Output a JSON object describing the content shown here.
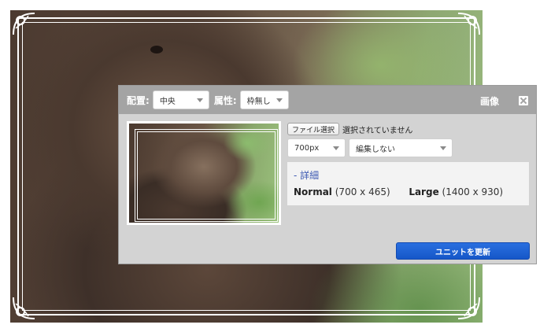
{
  "dialog": {
    "title": "画像",
    "close_icon": "close-icon",
    "header": {
      "align_label": "配置:",
      "align_value": "中央",
      "attribute_label": "属性:",
      "attribute_value": "枠無し"
    },
    "file": {
      "choose_label": "ファイル選択",
      "status": "選択されていません"
    },
    "size_select": "700px",
    "edit_select": "編集しない",
    "detail": {
      "toggle": "- 詳細",
      "normal_label": "Normal",
      "normal_size": "(700 x 465)",
      "large_label": "Large",
      "large_size": "(1400 x 930)"
    },
    "update_button": "ユニットを更新"
  },
  "colors": {
    "header_bg": "#a4a4a4",
    "dialog_bg": "#d3d3d3",
    "primary_button": "#1a5fd2",
    "detail_link": "#3d5ab3"
  }
}
